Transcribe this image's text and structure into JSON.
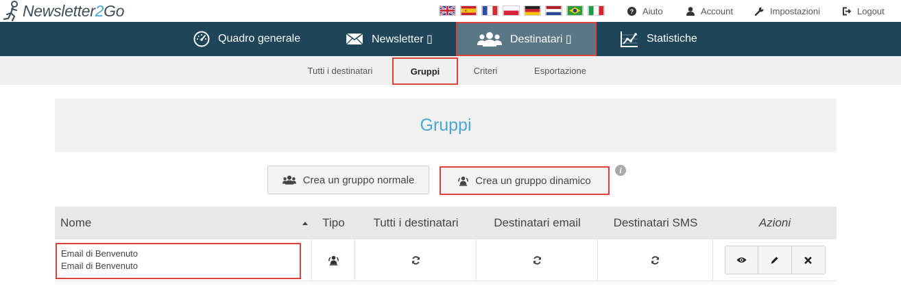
{
  "logo": {
    "prefix": "Newsletter",
    "two": "2",
    "suffix": "Go"
  },
  "languages": [
    {
      "name": "english"
    },
    {
      "name": "spanish"
    },
    {
      "name": "french"
    },
    {
      "name": "polish"
    },
    {
      "name": "german"
    },
    {
      "name": "dutch"
    },
    {
      "name": "portuguese"
    },
    {
      "name": "italian"
    }
  ],
  "toplinks": {
    "help": "Aiuto",
    "account": "Account",
    "settings": "Impostazioni",
    "logout": "Logout"
  },
  "mainnav": {
    "overview": "Quadro generale",
    "newsletter": "Newsletter ▯",
    "recipients": "Destinatari ▯",
    "statistics": "Statistiche"
  },
  "subnav": {
    "all": "Tutti i destinatari",
    "groups": "Gruppi",
    "criteria": "Criteri",
    "export": "Esportazione"
  },
  "page": {
    "title": "Gruppi"
  },
  "buttons": {
    "create_normal": "Crea un gruppo normale",
    "create_dynamic": "Crea un gruppo dinamico",
    "info": "i"
  },
  "table": {
    "headers": {
      "name": "Nome",
      "type": "Tipo",
      "all": "Tutti i destinatari",
      "email": "Destinatari email",
      "sms": "Destinatari SMS",
      "actions": "Azioni"
    },
    "rows": [
      {
        "name": "Email di Benvenuto",
        "description": "Email di Benvenuto",
        "type_icon": "dynamic-group-icon"
      }
    ]
  },
  "colors": {
    "nav_bg": "#1e4658",
    "nav_active": "#5a7786",
    "accent_blue": "#4aa6d6",
    "highlight_red": "#e0403c"
  }
}
